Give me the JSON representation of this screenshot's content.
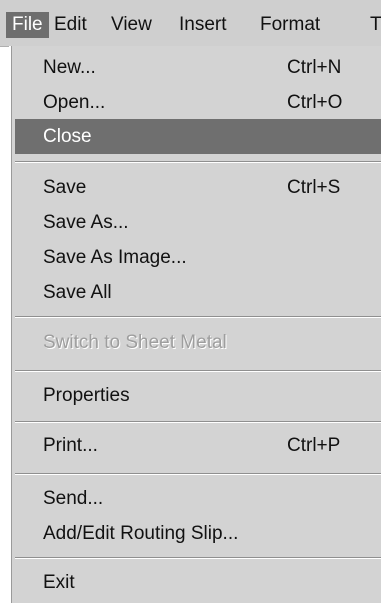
{
  "menubar": {
    "items": [
      {
        "label": "File"
      },
      {
        "label": "Edit"
      },
      {
        "label": "View"
      },
      {
        "label": "Insert"
      },
      {
        "label": "Format"
      },
      {
        "label": "T"
      }
    ]
  },
  "file_menu": {
    "items": [
      {
        "label": "New...",
        "shortcut": "Ctrl+N"
      },
      {
        "label": "Open...",
        "shortcut": "Ctrl+O"
      },
      {
        "label": "Close"
      },
      {
        "label": "Save",
        "shortcut": "Ctrl+S"
      },
      {
        "label": "Save As..."
      },
      {
        "label": "Save As Image..."
      },
      {
        "label": "Save All"
      },
      {
        "label": "Switch to Sheet Metal"
      },
      {
        "label": "Properties"
      },
      {
        "label": "Print...",
        "shortcut": "Ctrl+P"
      },
      {
        "label": "Send..."
      },
      {
        "label": "Add/Edit Routing Slip..."
      },
      {
        "label": "Exit"
      }
    ]
  }
}
